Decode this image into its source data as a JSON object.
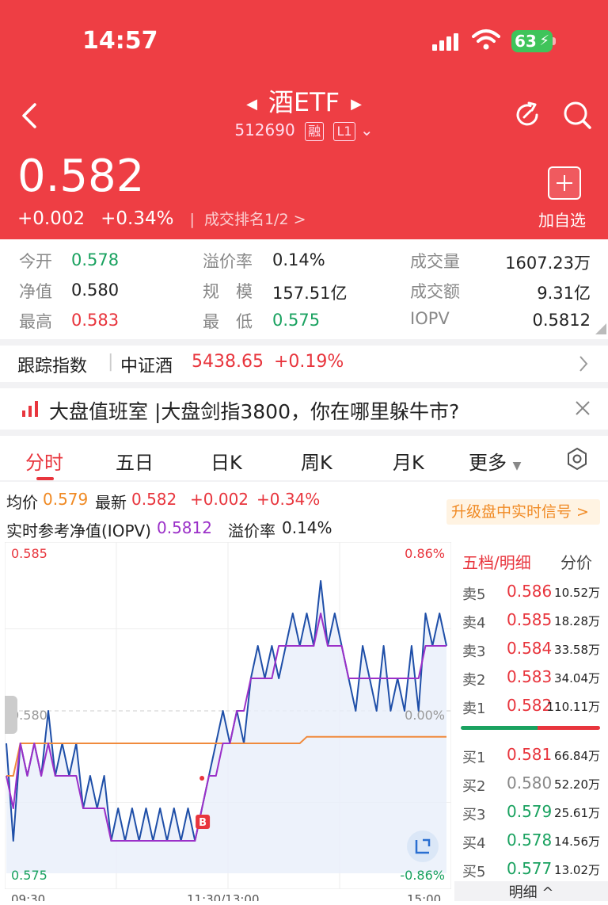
{
  "status": {
    "time": "14:57",
    "battery": "63"
  },
  "header": {
    "title": "酒ETF",
    "code": "512690",
    "tag1": "融",
    "tag2": "L1",
    "price": "0.582",
    "change": "+0.002",
    "change_pct": "+0.34%",
    "rank": "成交排名1/2 >",
    "add_label": "加自选"
  },
  "stats": {
    "open_l": "今开",
    "open_v": "0.578",
    "premium_l": "溢价率",
    "premium_v": "0.14%",
    "volume_l": "成交量",
    "volume_v": "1607.23万",
    "nav_l": "净值",
    "nav_v": "0.580",
    "scale_l": "规　模",
    "scale_v": "157.51亿",
    "amount_l": "成交额",
    "amount_v": "9.31亿",
    "high_l": "最高",
    "high_v": "0.583",
    "low_l": "最　低",
    "low_v": "0.575",
    "iopv_l": "IOPV",
    "iopv_v": "0.5812"
  },
  "tracking": {
    "label": "跟踪指数",
    "index": "中证酒",
    "value": "5438.65",
    "pct": "+0.19%"
  },
  "news": {
    "text": "大盘值班室 |大盘剑指3800，你在哪里躲牛市?"
  },
  "tabs": [
    "分时",
    "五日",
    "日K",
    "周K",
    "月K",
    "更多"
  ],
  "info": {
    "avg_l": "均价",
    "avg_v": "0.579",
    "last_l": "最新",
    "last_v": "0.582",
    "chg": "+0.002",
    "pct": "+0.34%",
    "iopv_l": "实时参考净值(IOPV)",
    "iopv_v": "0.5812",
    "prem_l": "溢价率",
    "prem_v": "0.14%",
    "upgrade": "升级盘中实时信号 >"
  },
  "chart_data": {
    "type": "line",
    "y_left_ticks": [
      "0.585",
      "0.580",
      "0.575"
    ],
    "y_right_ticks": [
      "0.86%",
      "0.00%",
      "-0.86%"
    ],
    "ylim": [
      0.575,
      0.585
    ],
    "x_ticks": [
      "09:30",
      "11:30/13:00",
      "15:00"
    ],
    "marker": "B",
    "series": [
      {
        "name": "price",
        "color": "#1f4fa8",
        "values": [
          0.579,
          0.576,
          0.579,
          0.578,
          0.579,
          0.578,
          0.58,
          0.578,
          0.579,
          0.578,
          0.579,
          0.577,
          0.578,
          0.577,
          0.578,
          0.576,
          0.577,
          0.576,
          0.577,
          0.576,
          0.577,
          0.576,
          0.577,
          0.576,
          0.577,
          0.576,
          0.577,
          0.576,
          0.577,
          0.578,
          0.579,
          0.58,
          0.579,
          0.58,
          0.579,
          0.581,
          0.582,
          0.581,
          0.582,
          0.581,
          0.582,
          0.583,
          0.582,
          0.583,
          0.582,
          0.584,
          0.582,
          0.583,
          0.582,
          0.581,
          0.58,
          0.582,
          0.581,
          0.58,
          0.582,
          0.58,
          0.581,
          0.58,
          0.582,
          0.58,
          0.583,
          0.582,
          0.583,
          0.582
        ]
      },
      {
        "name": "avg",
        "color": "#f08a3c",
        "values": [
          0.578,
          0.578,
          0.579,
          0.579,
          0.579,
          0.579,
          0.579,
          0.579,
          0.579,
          0.579,
          0.579,
          0.579,
          0.579,
          0.579,
          0.579,
          0.579,
          0.579,
          0.579,
          0.579,
          0.579,
          0.579,
          0.579,
          0.579,
          0.579,
          0.579,
          0.579,
          0.579,
          0.579,
          0.579,
          0.579,
          0.579,
          0.579,
          0.579,
          0.579,
          0.579,
          0.579,
          0.579,
          0.579,
          0.579,
          0.579,
          0.579,
          0.579,
          0.579,
          0.5792,
          0.5792,
          0.5792,
          0.5792,
          0.5792,
          0.5792,
          0.5792,
          0.5792,
          0.5792,
          0.5792,
          0.5792,
          0.5792,
          0.5792,
          0.5792,
          0.5792,
          0.5792,
          0.5792,
          0.5792,
          0.5792,
          0.5792,
          0.5792
        ]
      },
      {
        "name": "iopv",
        "color": "#9b30c8",
        "values": [
          0.578,
          0.577,
          0.579,
          0.578,
          0.579,
          0.578,
          0.579,
          0.578,
          0.578,
          0.578,
          0.578,
          0.577,
          0.577,
          0.577,
          0.577,
          0.576,
          0.576,
          0.576,
          0.576,
          0.576,
          0.576,
          0.576,
          0.576,
          0.576,
          0.576,
          0.576,
          0.576,
          0.576,
          0.577,
          0.578,
          0.578,
          0.579,
          0.579,
          0.58,
          0.58,
          0.581,
          0.581,
          0.581,
          0.581,
          0.582,
          0.582,
          0.582,
          0.582,
          0.582,
          0.582,
          0.583,
          0.582,
          0.582,
          0.582,
          0.581,
          0.581,
          0.581,
          0.581,
          0.581,
          0.581,
          0.581,
          0.581,
          0.581,
          0.581,
          0.581,
          0.582,
          0.582,
          0.582,
          0.582
        ]
      }
    ]
  },
  "book": {
    "title": "五档/明细",
    "split": "分价",
    "detail": "明细 ^",
    "sell": [
      {
        "l": "卖5",
        "p": "0.586",
        "v": "10.52万"
      },
      {
        "l": "卖4",
        "p": "0.585",
        "v": "18.28万"
      },
      {
        "l": "卖3",
        "p": "0.584",
        "v": "33.58万"
      },
      {
        "l": "卖2",
        "p": "0.583",
        "v": "34.04万"
      },
      {
        "l": "卖1",
        "p": "0.582",
        "v": "110.11万"
      }
    ],
    "buy": [
      {
        "l": "买1",
        "p": "0.581",
        "v": "66.84万"
      },
      {
        "l": "买2",
        "p": "0.580",
        "v": "52.20万"
      },
      {
        "l": "买3",
        "p": "0.579",
        "v": "25.61万"
      },
      {
        "l": "买4",
        "p": "0.578",
        "v": "14.56万"
      },
      {
        "l": "买5",
        "p": "0.577",
        "v": "13.02万"
      }
    ]
  }
}
